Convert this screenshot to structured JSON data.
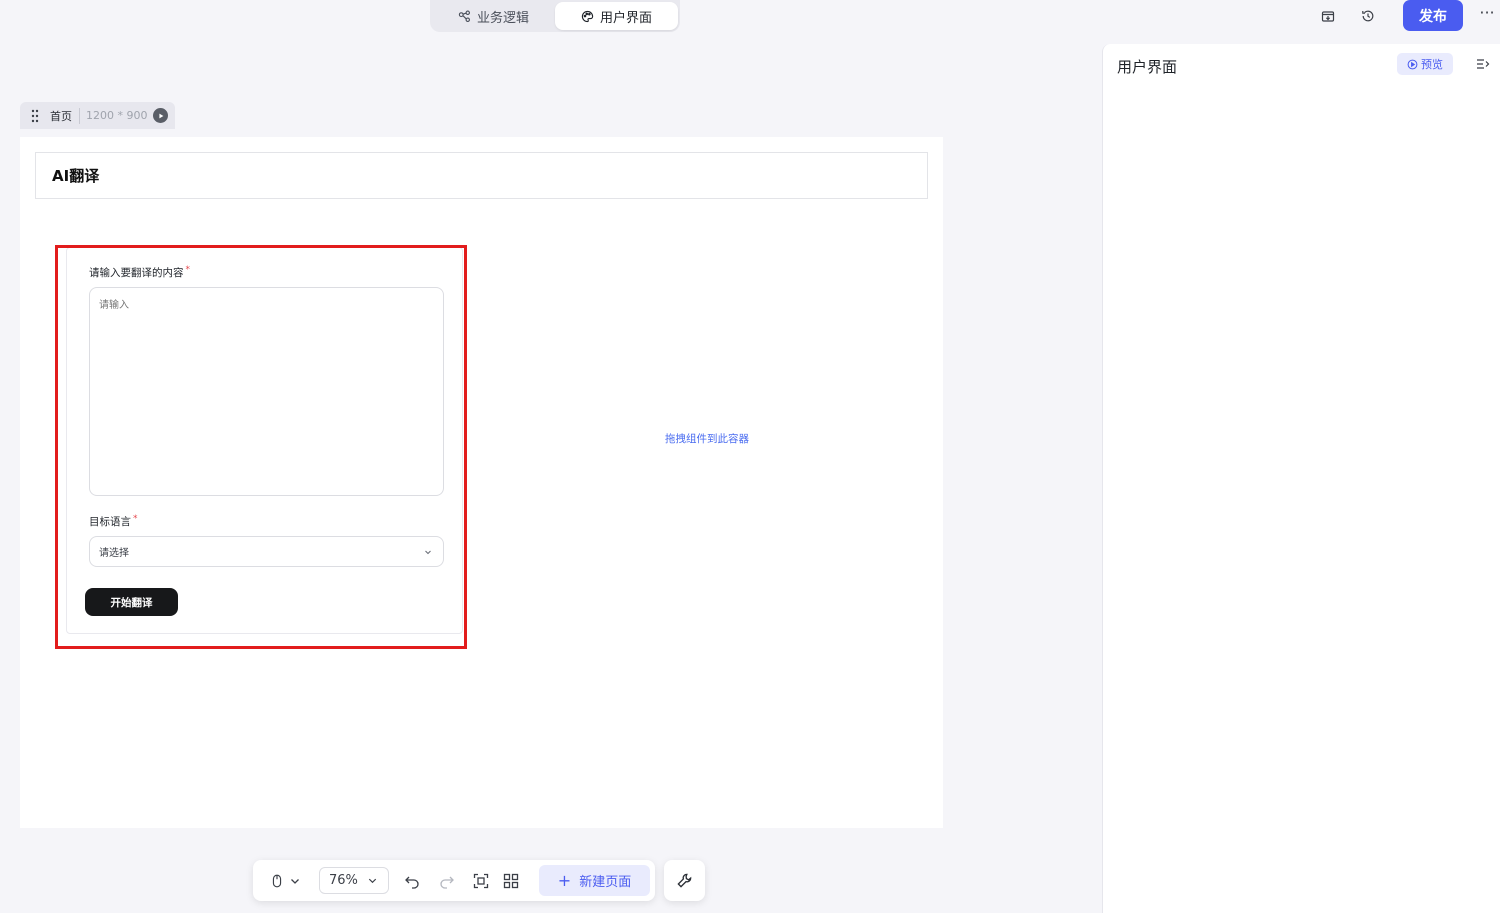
{
  "header": {
    "tabs": [
      {
        "label": "业务逻辑",
        "icon": "flow-icon"
      },
      {
        "label": "用户界面",
        "icon": "palette-icon"
      }
    ],
    "publish_label": "发布",
    "more_label": "···"
  },
  "page_chip": {
    "name": "首页",
    "size": "1200 * 900"
  },
  "canvas": {
    "title": "AI翻译",
    "form": {
      "content_label": "请输入要翻译的内容",
      "content_placeholder": "请输入",
      "language_label": "目标语言",
      "language_placeholder": "请选择",
      "required_mark": "*",
      "submit_label": "开始翻译"
    },
    "drop_hint": "拖拽组件到此容器"
  },
  "right_panel": {
    "title": "用户界面",
    "preview_label": "预览"
  },
  "toolbar": {
    "zoom": "76%",
    "new_page_label": "新建页面",
    "new_page_plus": "+"
  },
  "colors": {
    "accent": "#4a5cf0",
    "highlight": "#e21c1c",
    "submit_bg": "#17181a"
  }
}
